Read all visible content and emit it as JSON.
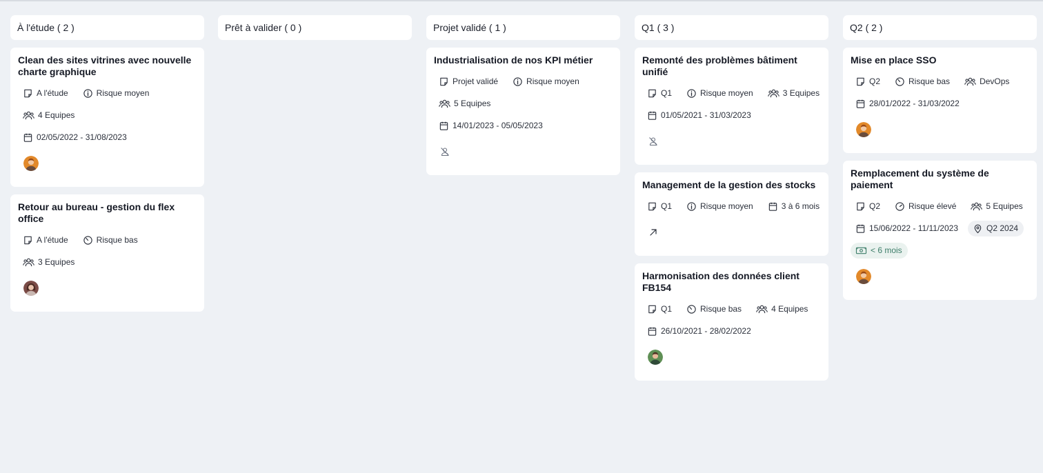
{
  "columns": [
    {
      "title": "À l'étude ( 2 )",
      "cards": [
        {
          "title": "Clean des sites vitrines avec nouvelle charte graphique",
          "status": "A l'étude",
          "risk": "Risque moyen",
          "teams": "4 Equipes",
          "dates": "02/05/2022 - 31/08/2023",
          "owner": "orange-avatar"
        },
        {
          "title": "Retour au bureau - gestion du flex office",
          "status": "A l'étude",
          "risk": "Risque bas",
          "teams": "3 Equipes",
          "owner": "brunette-avatar"
        }
      ]
    },
    {
      "title": "Prêt à valider ( 0 )",
      "cards": []
    },
    {
      "title": "Projet validé ( 1 )",
      "cards": [
        {
          "title": "Industrialisation de nos KPI métier",
          "status": "Projet validé",
          "risk": "Risque moyen",
          "teams": "5 Equipes",
          "dates": "14/01/2023 - 05/05/2023",
          "owner": "no-user-icon"
        }
      ]
    },
    {
      "title": "Q1 ( 3 )",
      "cards": [
        {
          "title": "Remonté des problèmes bâtiment unifié",
          "status": "Q1",
          "risk": "Risque moyen",
          "teams": "3 Equipes",
          "dates": "01/05/2021 - 31/03/2023",
          "owner": "no-user-icon"
        },
        {
          "title": "Management de la gestion des stocks",
          "status": "Q1",
          "risk": "Risque moyen",
          "duration": "3 à 6 mois",
          "owner": "arrow-up-right-icon"
        },
        {
          "title": "Harmonisation des données client FB154",
          "status": "Q1",
          "risk": "Risque bas",
          "teams": "4 Equipes",
          "dates": "26/10/2021 - 28/02/2022",
          "owner": "green-avatar"
        }
      ]
    },
    {
      "title": "Q2 ( 2 )",
      "cards": [
        {
          "title": "Mise en place SSO",
          "status": "Q2",
          "risk": "Risque bas",
          "teams": "DevOps",
          "dates": "28/01/2022 - 31/03/2022",
          "owner": "orange-avatar"
        },
        {
          "title": "Remplacement du système de paiement",
          "status": "Q2",
          "risk": "Risque élevé",
          "teams": "5 Equipes",
          "dates": "15/06/2022 - 11/11/2023",
          "milestone": "Q2 2024",
          "gain": "< 6 mois",
          "owner": "orange-avatar"
        }
      ]
    }
  ],
  "colors": {
    "background": "#eef1f5",
    "card": "#ffffff",
    "gain_text": "#3d7d69",
    "gain_background": "#eaf2ef"
  }
}
